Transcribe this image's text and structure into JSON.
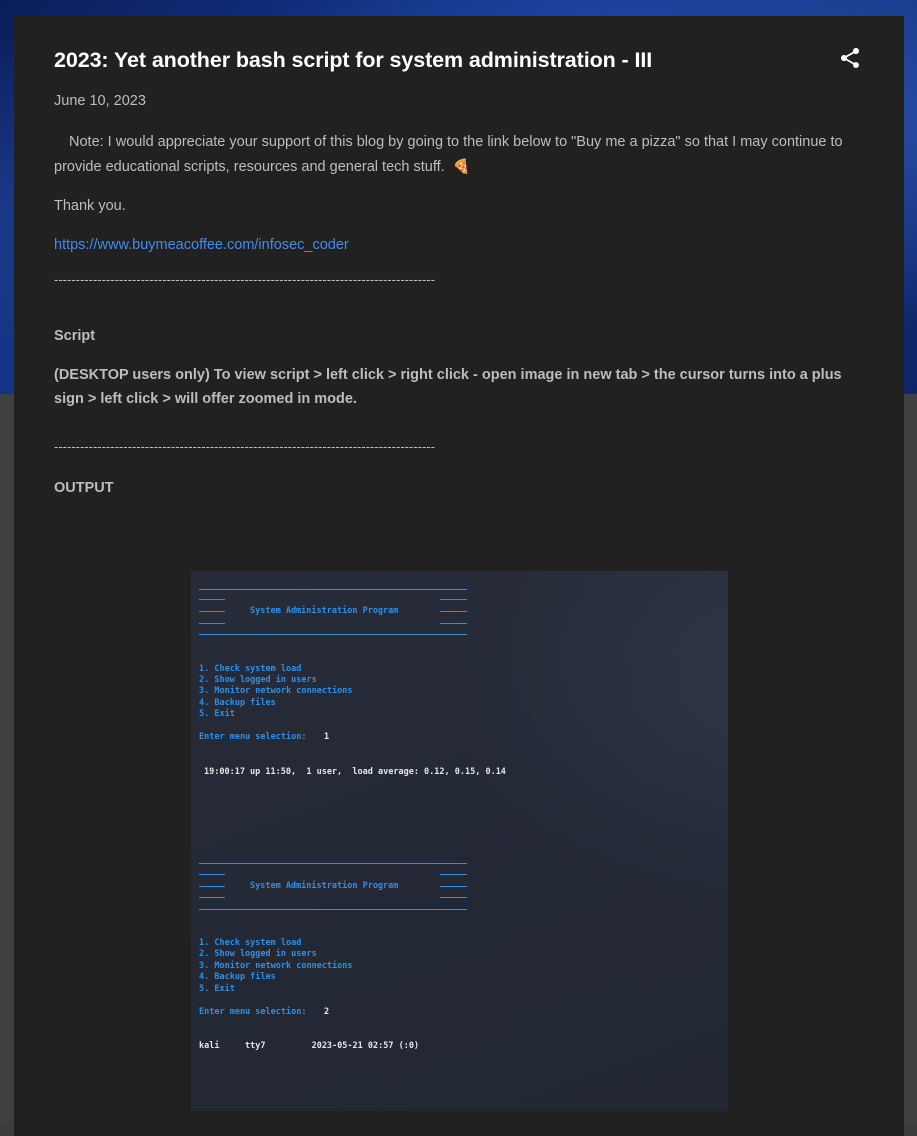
{
  "post": {
    "title": "2023: Yet another bash script for system administration - III",
    "date": "June 10, 2023",
    "note": "Note: I would appreciate your support of this blog by going to the link below to \"Buy me a pizza\" so that I may continue to provide educational scripts, resources and general tech stuff.",
    "pizza_emoji": "🍕",
    "thanks": "Thank you.",
    "link_text": "https://www.buymeacoffee.com/infosec_coder",
    "divider": "----------------------------------------------------------------------------------------",
    "script_label": "Script",
    "desktop_note": "(DESKTOP users only) To view script > left click > right click - open image in new tab > the cursor turns into a plus sign > left click > will offer zoomed in mode.",
    "output_label": "OUTPUT"
  },
  "icons": {
    "share": "share-icon"
  },
  "terminal": {
    "banner_title": "System Administration Program",
    "menu": [
      "1. Check system load",
      "2. Show logged in users",
      "3. Monitor network connections",
      "4. Backup files",
      "5. Exit"
    ],
    "prompt": "Enter menu selection:",
    "selection_1": "1",
    "output_1": "19:00:17 up 11:50,  1 user,  load average: 0.12, 0.15, 0.14",
    "selection_2": "2",
    "output_2": "kali     tty7         2023-05-21 02:57 (:0)"
  },
  "colors": {
    "card_bg": "#212121",
    "accent_link": "#3d8ef0",
    "terminal_blue": "#2f8fe6"
  }
}
